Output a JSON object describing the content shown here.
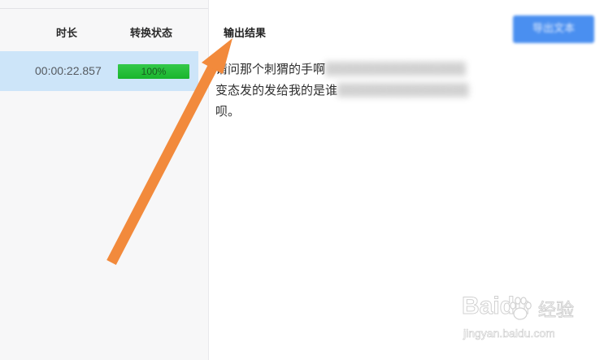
{
  "table": {
    "headers": {
      "duration": "时长",
      "status": "转换状态"
    },
    "rows": [
      {
        "duration": "00:00:22.857",
        "progress_percent": 100,
        "progress_label": "100%"
      }
    ]
  },
  "output": {
    "title": "输出结果",
    "export_button": "导出文本",
    "lines": [
      {
        "visible": "请问那个刺猬的手啊",
        "blurred": "▒▒▒▒▒▒▒▒▒▒▒▒▒▒▒"
      },
      {
        "visible": "变态发的发给我的是谁",
        "blurred": "▒▒▒▒▒▒▒▒▒▒▒▒▒▒"
      },
      {
        "visible": "呗。",
        "blurred": ""
      }
    ]
  },
  "colors": {
    "accent_blue": "#4a8ff0",
    "selected_row": "#cde5f9",
    "progress_green": "#19b52c",
    "arrow_orange": "#f28a3c"
  },
  "watermark": {
    "logo": "Baidu",
    "brand": "经验",
    "url": "jingyan.baidu.com"
  },
  "icons": {
    "annotation_arrow": "arrow-icon",
    "watermark_paw": "paw-icon"
  }
}
